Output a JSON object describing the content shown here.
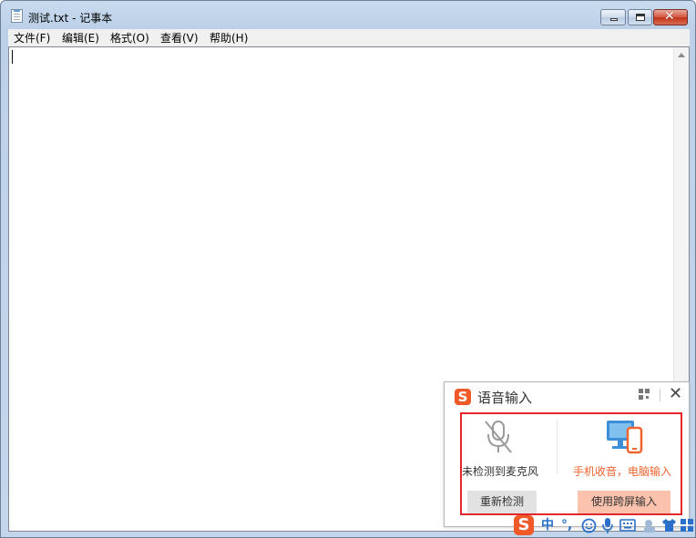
{
  "window": {
    "title": "测试.txt - 记事本"
  },
  "menu": {
    "items": [
      "文件(F)",
      "编辑(E)",
      "格式(O)",
      "查看(V)",
      "帮助(H)"
    ]
  },
  "editor": {
    "content": ""
  },
  "voice_popup": {
    "title": "语音输入",
    "no_mic_text": "未检测到麦克风",
    "phone_text": "手机收音，电脑输入",
    "retry_button": "重新检测",
    "cross_screen_button": "使用跨屏输入",
    "accent_color": "#f0642d",
    "highlight_color": "#e3272a"
  },
  "ime_toolbar": {
    "logo": "S",
    "mode": "中",
    "punct": "°,",
    "icons": [
      "emoji-icon",
      "mic-icon",
      "keyboard-icon",
      "tools-icon",
      "skin-icon",
      "menu-grid-icon"
    ]
  }
}
